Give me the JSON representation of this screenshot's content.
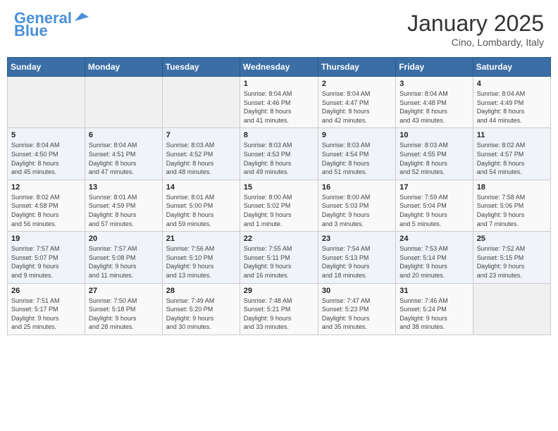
{
  "header": {
    "logo_line1": "General",
    "logo_line2": "Blue",
    "month": "January 2025",
    "location": "Cino, Lombardy, Italy"
  },
  "weekdays": [
    "Sunday",
    "Monday",
    "Tuesday",
    "Wednesday",
    "Thursday",
    "Friday",
    "Saturday"
  ],
  "weeks": [
    [
      {
        "day": "",
        "info": ""
      },
      {
        "day": "",
        "info": ""
      },
      {
        "day": "",
        "info": ""
      },
      {
        "day": "1",
        "info": "Sunrise: 8:04 AM\nSunset: 4:46 PM\nDaylight: 8 hours\nand 41 minutes."
      },
      {
        "day": "2",
        "info": "Sunrise: 8:04 AM\nSunset: 4:47 PM\nDaylight: 8 hours\nand 42 minutes."
      },
      {
        "day": "3",
        "info": "Sunrise: 8:04 AM\nSunset: 4:48 PM\nDaylight: 8 hours\nand 43 minutes."
      },
      {
        "day": "4",
        "info": "Sunrise: 8:04 AM\nSunset: 4:49 PM\nDaylight: 8 hours\nand 44 minutes."
      }
    ],
    [
      {
        "day": "5",
        "info": "Sunrise: 8:04 AM\nSunset: 4:50 PM\nDaylight: 8 hours\nand 45 minutes."
      },
      {
        "day": "6",
        "info": "Sunrise: 8:04 AM\nSunset: 4:51 PM\nDaylight: 8 hours\nand 47 minutes."
      },
      {
        "day": "7",
        "info": "Sunrise: 8:03 AM\nSunset: 4:52 PM\nDaylight: 8 hours\nand 48 minutes."
      },
      {
        "day": "8",
        "info": "Sunrise: 8:03 AM\nSunset: 4:53 PM\nDaylight: 8 hours\nand 49 minutes."
      },
      {
        "day": "9",
        "info": "Sunrise: 8:03 AM\nSunset: 4:54 PM\nDaylight: 8 hours\nand 51 minutes."
      },
      {
        "day": "10",
        "info": "Sunrise: 8:03 AM\nSunset: 4:55 PM\nDaylight: 8 hours\nand 52 minutes."
      },
      {
        "day": "11",
        "info": "Sunrise: 8:02 AM\nSunset: 4:57 PM\nDaylight: 8 hours\nand 54 minutes."
      }
    ],
    [
      {
        "day": "12",
        "info": "Sunrise: 8:02 AM\nSunset: 4:58 PM\nDaylight: 8 hours\nand 56 minutes."
      },
      {
        "day": "13",
        "info": "Sunrise: 8:01 AM\nSunset: 4:59 PM\nDaylight: 8 hours\nand 57 minutes."
      },
      {
        "day": "14",
        "info": "Sunrise: 8:01 AM\nSunset: 5:00 PM\nDaylight: 8 hours\nand 59 minutes."
      },
      {
        "day": "15",
        "info": "Sunrise: 8:00 AM\nSunset: 5:02 PM\nDaylight: 9 hours\nand 1 minute."
      },
      {
        "day": "16",
        "info": "Sunrise: 8:00 AM\nSunset: 5:03 PM\nDaylight: 9 hours\nand 3 minutes."
      },
      {
        "day": "17",
        "info": "Sunrise: 7:59 AM\nSunset: 5:04 PM\nDaylight: 9 hours\nand 5 minutes."
      },
      {
        "day": "18",
        "info": "Sunrise: 7:58 AM\nSunset: 5:06 PM\nDaylight: 9 hours\nand 7 minutes."
      }
    ],
    [
      {
        "day": "19",
        "info": "Sunrise: 7:57 AM\nSunset: 5:07 PM\nDaylight: 9 hours\nand 9 minutes."
      },
      {
        "day": "20",
        "info": "Sunrise: 7:57 AM\nSunset: 5:08 PM\nDaylight: 9 hours\nand 11 minutes."
      },
      {
        "day": "21",
        "info": "Sunrise: 7:56 AM\nSunset: 5:10 PM\nDaylight: 9 hours\nand 13 minutes."
      },
      {
        "day": "22",
        "info": "Sunrise: 7:55 AM\nSunset: 5:11 PM\nDaylight: 9 hours\nand 16 minutes."
      },
      {
        "day": "23",
        "info": "Sunrise: 7:54 AM\nSunset: 5:13 PM\nDaylight: 9 hours\nand 18 minutes."
      },
      {
        "day": "24",
        "info": "Sunrise: 7:53 AM\nSunset: 5:14 PM\nDaylight: 9 hours\nand 20 minutes."
      },
      {
        "day": "25",
        "info": "Sunrise: 7:52 AM\nSunset: 5:15 PM\nDaylight: 9 hours\nand 23 minutes."
      }
    ],
    [
      {
        "day": "26",
        "info": "Sunrise: 7:51 AM\nSunset: 5:17 PM\nDaylight: 9 hours\nand 25 minutes."
      },
      {
        "day": "27",
        "info": "Sunrise: 7:50 AM\nSunset: 5:18 PM\nDaylight: 9 hours\nand 28 minutes."
      },
      {
        "day": "28",
        "info": "Sunrise: 7:49 AM\nSunset: 5:20 PM\nDaylight: 9 hours\nand 30 minutes."
      },
      {
        "day": "29",
        "info": "Sunrise: 7:48 AM\nSunset: 5:21 PM\nDaylight: 9 hours\nand 33 minutes."
      },
      {
        "day": "30",
        "info": "Sunrise: 7:47 AM\nSunset: 5:23 PM\nDaylight: 9 hours\nand 35 minutes."
      },
      {
        "day": "31",
        "info": "Sunrise: 7:46 AM\nSunset: 5:24 PM\nDaylight: 9 hours\nand 38 minutes."
      },
      {
        "day": "",
        "info": ""
      }
    ]
  ]
}
